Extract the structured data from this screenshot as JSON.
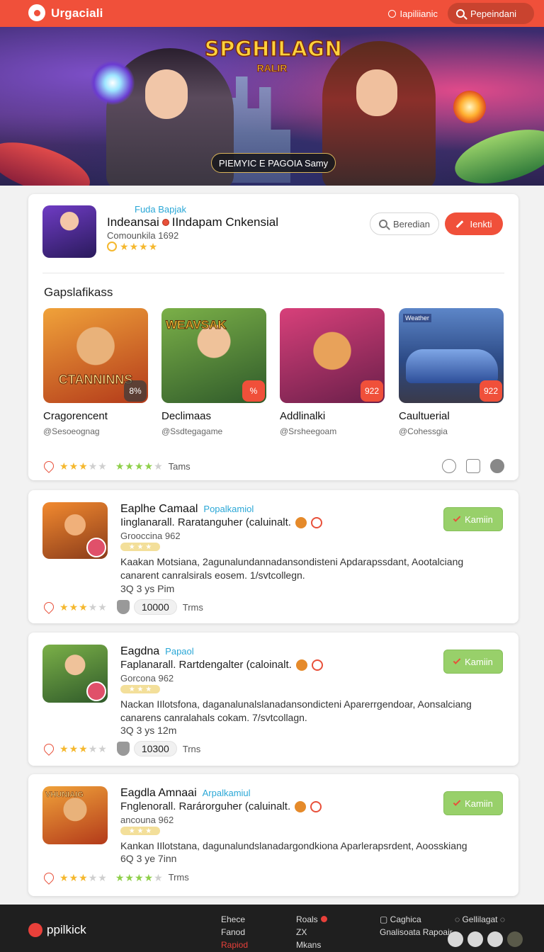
{
  "header": {
    "brand": "Urgaciali",
    "link": "Iapiliianic",
    "search": "Pepeindani"
  },
  "hero": {
    "title": "SPGHILAGN",
    "subtitle": "RALIR",
    "button": "PIEMYIC E PAGOIA Samy"
  },
  "featured": {
    "category": "Fuda Bapjak",
    "title": "Indeansai",
    "title_rest": "IIndapam Cnkensial",
    "meta": "Comounkila 1692",
    "secondary_button": "Beredian",
    "primary_button": "Ienkti",
    "section_title": "Gapslafikass",
    "tiles": [
      {
        "name": "Cragorencent",
        "sub": "@Sesoeognag",
        "badge": "8%"
      },
      {
        "name": "Declimaas",
        "sub": "@Ssdtegagame",
        "badge": "%"
      },
      {
        "name": "Addlinalki",
        "sub": "@Srsheegoam",
        "badge": "922"
      },
      {
        "name": "Caultuerial",
        "sub": "@Cohessgia",
        "badge": "922"
      }
    ],
    "tile_art": [
      "CTANNINNS",
      "WEAVSAK"
    ],
    "tile_tag": "Weather",
    "foot_label": "Tams"
  },
  "list": [
    {
      "title": "Eaplhe Camaal",
      "category": "Popalkamiol",
      "line1": "Iinglanarall. Raratanguher (caluinalt.",
      "meta": "Grooccina 962",
      "body": "Kaakan Motsiana, 2agunalundannadansondisteni Apdarapssdant, Aootalciang canarent canralsirals eosem. 1/svtcollegn.",
      "time": "3Q 3 ys Pim",
      "count": "10000",
      "foot_label": "Trms",
      "button": "Kamiin"
    },
    {
      "title": "Eagdna",
      "category": "Papaol",
      "line1": "Faplanarall. Rartdengalter (caloinalt.",
      "meta": "Gorcona 962",
      "body": "Nackan IIlotsfona, daganalunalslanadansondicteni Aparerrgendoar, Aonsalciang canarens canralahals cokam. 7/svtcollagn.",
      "time": "3Q 3 ys 12m",
      "count": "10300",
      "foot_label": "Trns",
      "button": "Kamiin"
    },
    {
      "title": "Eagdla Amnaai",
      "category": "Arpalkamiul",
      "line1": "Fnglenorall. Rarárorguher (caluinalt.",
      "meta": "ancouna 962",
      "body": "Kankan IIlotstana, dagunalundslanadargondkiona Aparlerapsrdent, Aoosskiang",
      "time": "6Q 3 ye 7inn",
      "foot_label": "Trms",
      "thumb_label": "VHUNIAIG",
      "button": "Kamiin"
    }
  ],
  "footer": {
    "logo": "ppilkick",
    "col1": [
      "Ehece",
      "Fanod",
      "Rapiod"
    ],
    "col2": [
      "Roals",
      "ZX",
      "Mkans"
    ],
    "col3": [
      "Caghica",
      "Gnalisoata Rapoair"
    ],
    "col4": [
      "Gellilagat"
    ]
  },
  "colors": {
    "accent": "#f0503a",
    "link": "#2aa7d6",
    "success": "#98d06a",
    "footer": "#1f1f1f"
  }
}
